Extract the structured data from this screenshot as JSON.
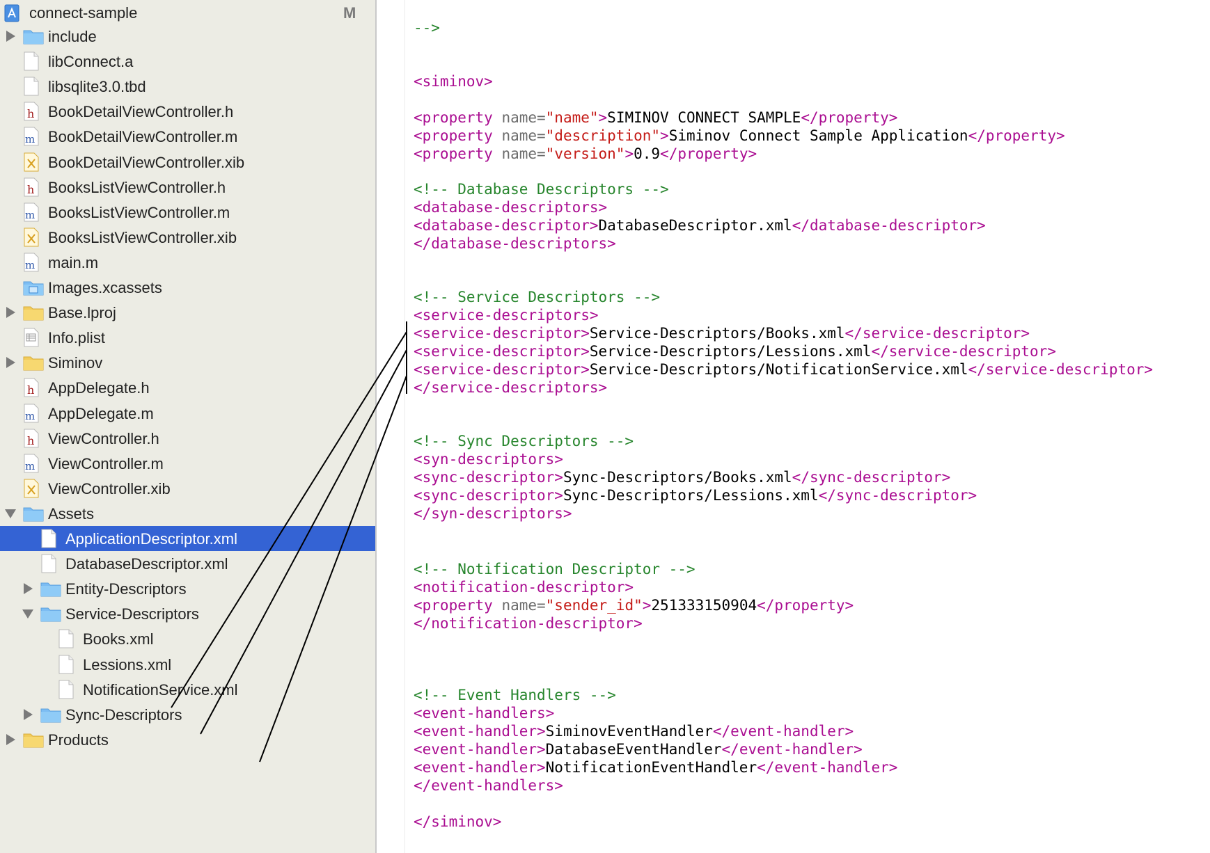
{
  "navigator": {
    "project": {
      "label": "connect-sample",
      "badge": "M"
    },
    "items": [
      {
        "label": "include",
        "icon": "folder-icon",
        "indent": 0,
        "disclosure": "collapsed"
      },
      {
        "label": "libConnect.a",
        "icon": "file-icon",
        "indent": 0,
        "disclosure": "none"
      },
      {
        "label": "libsqlite3.0.tbd",
        "icon": "file-icon",
        "indent": 0,
        "disclosure": "none"
      },
      {
        "label": "BookDetailViewController.h",
        "icon": "header-file-icon",
        "indent": 0,
        "disclosure": "none"
      },
      {
        "label": "BookDetailViewController.m",
        "icon": "objc-file-icon",
        "indent": 0,
        "disclosure": "none"
      },
      {
        "label": "BookDetailViewController.xib",
        "icon": "xib-file-icon",
        "indent": 0,
        "disclosure": "none"
      },
      {
        "label": "BooksListViewController.h",
        "icon": "header-file-icon",
        "indent": 0,
        "disclosure": "none"
      },
      {
        "label": "BooksListViewController.m",
        "icon": "objc-file-icon",
        "indent": 0,
        "disclosure": "none"
      },
      {
        "label": "BooksListViewController.xib",
        "icon": "xib-file-icon",
        "indent": 0,
        "disclosure": "none"
      },
      {
        "label": "main.m",
        "icon": "objc-file-icon",
        "indent": 0,
        "disclosure": "none"
      },
      {
        "label": "Images.xcassets",
        "icon": "asset-catalog-icon",
        "indent": 0,
        "disclosure": "none"
      },
      {
        "label": "Base.lproj",
        "icon": "yellow-folder-icon",
        "indent": 0,
        "disclosure": "collapsed"
      },
      {
        "label": "Info.plist",
        "icon": "plist-file-icon",
        "indent": 0,
        "disclosure": "none"
      },
      {
        "label": "Siminov",
        "icon": "yellow-folder-icon",
        "indent": 0,
        "disclosure": "collapsed"
      },
      {
        "label": "AppDelegate.h",
        "icon": "header-file-icon",
        "indent": 0,
        "disclosure": "none"
      },
      {
        "label": "AppDelegate.m",
        "icon": "objc-file-icon",
        "indent": 0,
        "disclosure": "none"
      },
      {
        "label": "ViewController.h",
        "icon": "header-file-icon",
        "indent": 0,
        "disclosure": "none"
      },
      {
        "label": "ViewController.m",
        "icon": "objc-file-icon",
        "indent": 0,
        "disclosure": "none"
      },
      {
        "label": "ViewController.xib",
        "icon": "xib-file-icon",
        "indent": 0,
        "disclosure": "none"
      },
      {
        "label": "Assets",
        "icon": "folder-icon",
        "indent": 0,
        "disclosure": "expanded"
      },
      {
        "label": "ApplicationDescriptor.xml",
        "icon": "file-icon",
        "indent": 1,
        "disclosure": "none",
        "selected": true
      },
      {
        "label": "DatabaseDescriptor.xml",
        "icon": "file-icon",
        "indent": 1,
        "disclosure": "none"
      },
      {
        "label": "Entity-Descriptors",
        "icon": "folder-icon",
        "indent": 1,
        "disclosure": "collapsed"
      },
      {
        "label": "Service-Descriptors",
        "icon": "folder-icon",
        "indent": 1,
        "disclosure": "expanded"
      },
      {
        "label": "Books.xml",
        "icon": "file-icon",
        "indent": 2,
        "disclosure": "none"
      },
      {
        "label": "Lessions.xml",
        "icon": "file-icon",
        "indent": 2,
        "disclosure": "none"
      },
      {
        "label": "NotificationService.xml",
        "icon": "file-icon",
        "indent": 2,
        "disclosure": "none"
      },
      {
        "label": "Sync-Descriptors",
        "icon": "folder-icon",
        "indent": 1,
        "disclosure": "collapsed"
      },
      {
        "label": "Products",
        "icon": "yellow-folder-icon",
        "indent": 0,
        "disclosure": "collapsed"
      }
    ]
  },
  "editor": {
    "lines": [
      {
        "segments": [
          {
            "t": "cmt",
            "v": "-->"
          }
        ]
      },
      {
        "segments": [
          {
            "t": "tag",
            "v": "<siminov>"
          }
        ]
      },
      {
        "segments": [
          {
            "t": "tag",
            "v": "<property "
          },
          {
            "t": "attr",
            "v": "name="
          },
          {
            "t": "str",
            "v": "\"name\""
          },
          {
            "t": "tag",
            "v": ">"
          },
          {
            "t": "txt",
            "v": "SIMINOV CONNECT SAMPLE"
          },
          {
            "t": "tag",
            "v": "</property>"
          }
        ]
      },
      {
        "segments": [
          {
            "t": "tag",
            "v": "<property "
          },
          {
            "t": "attr",
            "v": "name="
          },
          {
            "t": "str",
            "v": "\"description\""
          },
          {
            "t": "tag",
            "v": ">"
          },
          {
            "t": "txt",
            "v": "Siminov Connect Sample Application"
          },
          {
            "t": "tag",
            "v": "</property>"
          }
        ]
      },
      {
        "segments": [
          {
            "t": "tag",
            "v": "<property "
          },
          {
            "t": "attr",
            "v": "name="
          },
          {
            "t": "str",
            "v": "\"version\""
          },
          {
            "t": "tag",
            "v": ">"
          },
          {
            "t": "txt",
            "v": "0.9"
          },
          {
            "t": "tag",
            "v": "</property>"
          }
        ]
      },
      {
        "segments": [
          {
            "t": "cmt",
            "v": "<!-- Database Descriptors -->"
          }
        ]
      },
      {
        "segments": [
          {
            "t": "tag",
            "v": "<database-descriptors>"
          }
        ]
      },
      {
        "segments": [
          {
            "t": "tag",
            "v": "<database-descriptor>"
          },
          {
            "t": "txt",
            "v": "DatabaseDescriptor.xml"
          },
          {
            "t": "tag",
            "v": "</database-descriptor>"
          }
        ]
      },
      {
        "segments": [
          {
            "t": "tag",
            "v": "</database-descriptors>"
          }
        ]
      },
      {
        "segments": [
          {
            "t": "cmt",
            "v": "<!-- Service Descriptors -->"
          }
        ]
      },
      {
        "segments": [
          {
            "t": "tag",
            "v": "<service-descriptors>"
          }
        ]
      },
      {
        "segments": [
          {
            "t": "tag",
            "v": "<service-descriptor>"
          },
          {
            "t": "txt",
            "v": "Service-Descriptors/Books.xml"
          },
          {
            "t": "tag",
            "v": "</service-descriptor>"
          }
        ]
      },
      {
        "segments": [
          {
            "t": "tag",
            "v": "<service-descriptor>"
          },
          {
            "t": "txt",
            "v": "Service-Descriptors/Lessions.xml"
          },
          {
            "t": "tag",
            "v": "</service-descriptor>"
          }
        ]
      },
      {
        "segments": [
          {
            "t": "tag",
            "v": "<service-descriptor>"
          },
          {
            "t": "txt",
            "v": "Service-Descriptors/NotificationService.xml"
          },
          {
            "t": "tag",
            "v": "</service-descriptor>"
          }
        ]
      },
      {
        "segments": [
          {
            "t": "tag",
            "v": "</service-descriptors>"
          }
        ]
      },
      {
        "segments": [
          {
            "t": "cmt",
            "v": "<!-- Sync Descriptors -->"
          }
        ]
      },
      {
        "segments": [
          {
            "t": "tag",
            "v": "<syn-descriptors>"
          }
        ]
      },
      {
        "segments": [
          {
            "t": "tag",
            "v": "<sync-descriptor>"
          },
          {
            "t": "txt",
            "v": "Sync-Descriptors/Books.xml"
          },
          {
            "t": "tag",
            "v": "</sync-descriptor>"
          }
        ]
      },
      {
        "segments": [
          {
            "t": "tag",
            "v": "<sync-descriptor>"
          },
          {
            "t": "txt",
            "v": "Sync-Descriptors/Lessions.xml"
          },
          {
            "t": "tag",
            "v": "</sync-descriptor>"
          }
        ]
      },
      {
        "segments": [
          {
            "t": "tag",
            "v": "</syn-descriptors>"
          }
        ]
      },
      {
        "segments": [
          {
            "t": "cmt",
            "v": "<!-- Notification Descriptor -->"
          }
        ]
      },
      {
        "segments": [
          {
            "t": "tag",
            "v": "<notification-descriptor>"
          }
        ]
      },
      {
        "segments": [
          {
            "t": "tag",
            "v": "<property "
          },
          {
            "t": "attr",
            "v": "name="
          },
          {
            "t": "str",
            "v": "\"sender_id\""
          },
          {
            "t": "tag",
            "v": ">"
          },
          {
            "t": "txt",
            "v": "251333150904"
          },
          {
            "t": "tag",
            "v": "</property>"
          }
        ]
      },
      {
        "segments": [
          {
            "t": "tag",
            "v": "</notification-descriptor>"
          }
        ]
      },
      {
        "segments": [
          {
            "t": "cmt",
            "v": "<!-- Event Handlers -->"
          }
        ]
      },
      {
        "segments": [
          {
            "t": "tag",
            "v": "<event-handlers>"
          }
        ]
      },
      {
        "segments": [
          {
            "t": "tag",
            "v": "<event-handler>"
          },
          {
            "t": "txt",
            "v": "SiminovEventHandler"
          },
          {
            "t": "tag",
            "v": "</event-handler>"
          }
        ]
      },
      {
        "segments": [
          {
            "t": "tag",
            "v": "<event-handler>"
          },
          {
            "t": "txt",
            "v": "DatabaseEventHandler"
          },
          {
            "t": "tag",
            "v": "</event-handler>"
          }
        ]
      },
      {
        "segments": [
          {
            "t": "tag",
            "v": "<event-handler>"
          },
          {
            "t": "txt",
            "v": "NotificationEventHandler"
          },
          {
            "t": "tag",
            "v": "</event-handler>"
          }
        ]
      },
      {
        "segments": [
          {
            "t": "tag",
            "v": "</event-handlers>"
          }
        ]
      },
      {
        "segments": [
          {
            "t": "tag",
            "v": "</siminov>"
          }
        ]
      }
    ]
  },
  "colors": {
    "selection": "#3463d4",
    "xml_tag": "#aa0d91",
    "xml_string": "#c41a16",
    "xml_comment": "#26852c",
    "xml_attribute": "#6b6b6b"
  }
}
